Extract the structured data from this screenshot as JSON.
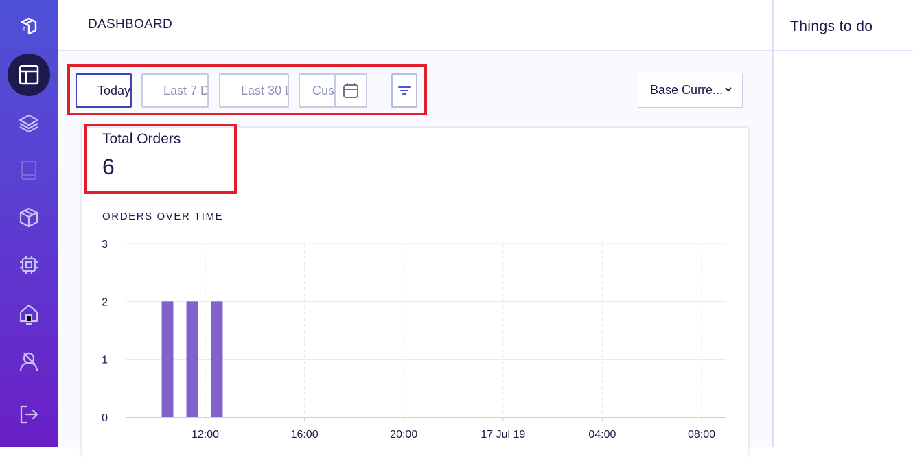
{
  "header": {
    "title": "DASHBOARD"
  },
  "right_panel": {
    "title": "Things to do"
  },
  "filters": [
    {
      "label": "Today",
      "active": true
    },
    {
      "label": "Last 7 D",
      "active": false
    },
    {
      "label": "Last 30 D",
      "active": false
    },
    {
      "label": "Cus",
      "active": false
    }
  ],
  "currency": {
    "label": "Base Curre..."
  },
  "metric": {
    "label": "Total Orders",
    "value": "6"
  },
  "chart_title": "ORDERS OVER TIME",
  "sidebar": {
    "icons": [
      "logo-icon",
      "dashboard-icon",
      "layers-icon",
      "book-icon",
      "box-icon",
      "chip-icon",
      "home-icon",
      "user-icon",
      "logout-icon"
    ]
  },
  "colors": {
    "accent": "#4e51d6",
    "bar": "#8162cc",
    "highlight": "#e31d2b"
  },
  "chart_data": {
    "type": "bar",
    "title": "ORDERS OVER TIME",
    "xlabel": "",
    "ylabel": "",
    "ylim": [
      0,
      3
    ],
    "yticks": [
      "0",
      "1",
      "2",
      "3"
    ],
    "xticks": [
      "12:00",
      "16:00",
      "20:00",
      "17 Jul 19",
      "04:00",
      "08:00"
    ],
    "categories": [
      "10:00-11:00",
      "11:00-12:00",
      "12:00-13:00"
    ],
    "values": [
      2,
      2,
      2
    ],
    "grid": true
  }
}
